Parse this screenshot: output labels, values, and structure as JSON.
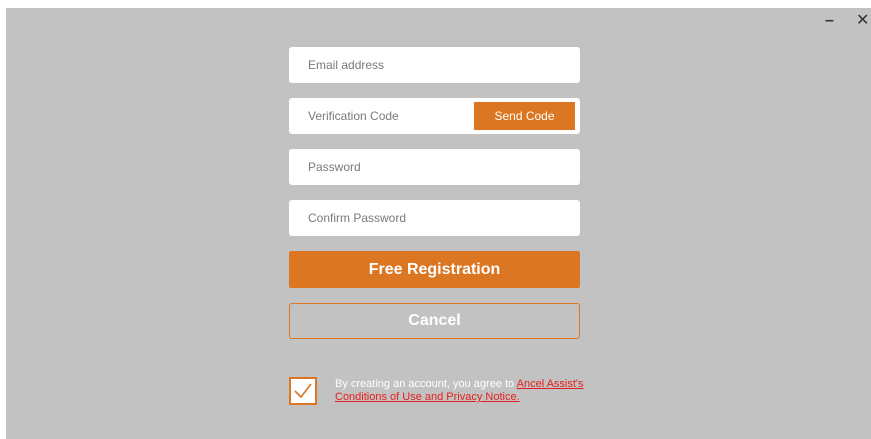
{
  "window": {
    "minimize_label": "–",
    "close_label": "✕"
  },
  "form": {
    "email_placeholder": "Email address",
    "verification_placeholder": "Verification Code",
    "send_code_label": "Send Code",
    "password_placeholder": "Password",
    "confirm_password_placeholder": "Confirm Password",
    "register_label": "Free Registration",
    "cancel_label": "Cancel"
  },
  "terms": {
    "checked": true,
    "prefix": "By creating an account, you agree to ",
    "link_1": "Ancel Assist's",
    "link_2": "Conditions of Use and Privacy Notice."
  },
  "colors": {
    "background": "#c2c2c2",
    "accent": "#db7722",
    "link": "#e51e1e"
  }
}
